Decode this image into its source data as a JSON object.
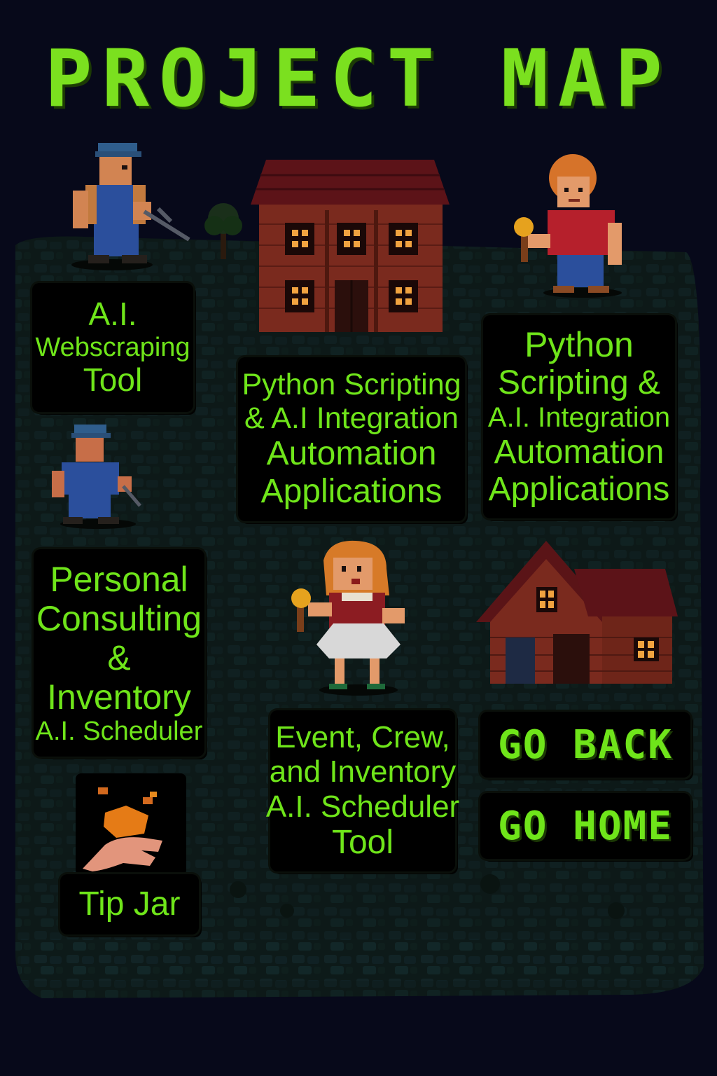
{
  "title": "PROJECT MAP",
  "panels": {
    "webscraping": {
      "lines": [
        "A.I.",
        "Webscraping",
        "Tool"
      ]
    },
    "python_center": {
      "lines": [
        "Python Scripting",
        "& A.I Integration",
        "Automation",
        "Applications"
      ]
    },
    "python_right": {
      "lines": [
        "Python",
        "Scripting &",
        "A.I. Integration",
        "Automation",
        "Applications"
      ]
    },
    "consulting": {
      "lines": [
        "Personal",
        "Consulting",
        "&",
        "Inventory",
        "A.I. Scheduler"
      ]
    },
    "event": {
      "lines": [
        "Event, Crew,",
        "and Inventory",
        "A.I. Scheduler",
        "Tool"
      ]
    },
    "tipjar": {
      "lines": [
        "Tip Jar"
      ]
    }
  },
  "buttons": {
    "go_back": "GO BACK",
    "go_home": "GO HOME"
  },
  "icons": [
    "farmer-with-pickaxe",
    "miner-with-pickaxe",
    "boy-with-ice-cream",
    "girl-with-ice-cream",
    "tipping-hand",
    "two-story-brick-house",
    "small-brick-cottage",
    "tree"
  ],
  "colors": {
    "accent_green": "#6fe51a",
    "background": "#07091a",
    "panel": "#000000",
    "path": "#0f1f1e"
  }
}
